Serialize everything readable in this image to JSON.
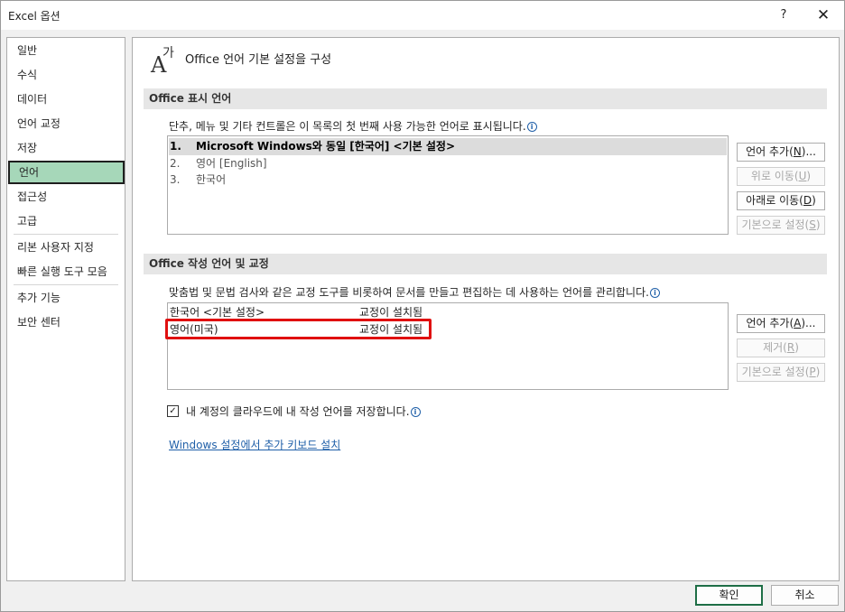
{
  "window": {
    "title": "Excel 옵션",
    "help_label": "?",
    "close_label": "✕"
  },
  "sidebar": {
    "items": [
      {
        "label": "일반"
      },
      {
        "label": "수식"
      },
      {
        "label": "데이터"
      },
      {
        "label": "언어 교정"
      },
      {
        "label": "저장"
      },
      {
        "label": "언어"
      },
      {
        "label": "접근성"
      },
      {
        "label": "고급"
      },
      {
        "label": "리본 사용자 지정"
      },
      {
        "label": "빠른 실행 도구 모음"
      },
      {
        "label": "추가 기능"
      },
      {
        "label": "보안 센터"
      }
    ],
    "active": "언어"
  },
  "header": {
    "icon_glyph_a": "A",
    "icon_glyph_ga": "가",
    "title": "Office 언어 기본 설정을 구성"
  },
  "display_language": {
    "section_title": "Office 표시 언어",
    "description": "단추, 메뉴 및 기타 컨트롤은 이 목록의 첫 번째 사용 가능한 언어로 표시됩니다.",
    "info_glyph": "i",
    "rows": [
      {
        "num": "1.",
        "label": "Microsoft Windows와 동일 [한국어] <기본 설정>"
      },
      {
        "num": "2.",
        "label": "영어 [English]"
      },
      {
        "num": "3.",
        "label": "한국어"
      }
    ],
    "buttons": {
      "add": {
        "pre": "언어 추가(",
        "key": "N",
        "post": ")..."
      },
      "up": {
        "pre": "위로 이동(",
        "key": "U",
        "post": ")"
      },
      "down": {
        "pre": "아래로 이동(",
        "key": "D",
        "post": ")"
      },
      "default": {
        "pre": "기본으로 설정(",
        "key": "S",
        "post": ")"
      }
    }
  },
  "authoring_language": {
    "section_title": "Office 작성 언어 및 교정",
    "description": "맞춤법 및 문법 검사와 같은 교정 도구를 비롯하여 문서를 만들고 편집하는 데 사용하는 언어를 관리합니다.",
    "info_glyph": "i",
    "rows": [
      {
        "language": "한국어 <기본 설정>",
        "status": "교정이 설치됨"
      },
      {
        "language": "영어(미국)",
        "status": "교정이 설치됨"
      }
    ],
    "buttons": {
      "add": {
        "pre": "언어 추가(",
        "key": "A",
        "post": ")..."
      },
      "remove": {
        "pre": "제거(",
        "key": "R",
        "post": ")"
      },
      "default": {
        "pre": "기본으로 설정(",
        "key": "P",
        "post": ")"
      }
    }
  },
  "cloud_option": {
    "checked": true,
    "check_glyph": "✓",
    "label": "내 계정의 클라우드에 내 작성 언어를 저장합니다.",
    "info_glyph": "i"
  },
  "keyboard_link": "Windows 설정에서 추가 키보드 설치",
  "footer": {
    "ok_label": "확인",
    "cancel_label": "취소"
  }
}
